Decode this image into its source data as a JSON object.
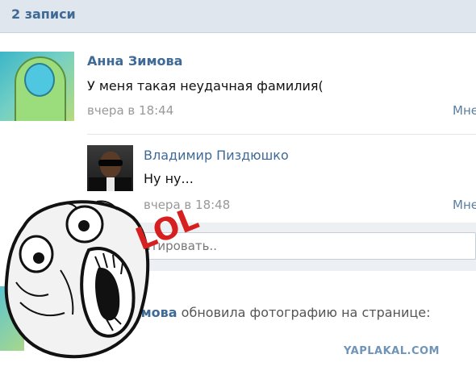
{
  "header": {
    "title": "2 записи"
  },
  "post1": {
    "author": "Анна Зимова",
    "text": "У меня такая неудачная фамилия(",
    "date": "вчера в 18:44",
    "more": "Мне"
  },
  "reply": {
    "author": "Владимир Пиздюшко",
    "text": "Ну ну...",
    "date": "вчера в 18:48",
    "more": "Мне"
  },
  "comment": {
    "placeholder": "мментировать.."
  },
  "post2": {
    "author_part": "Зимова",
    "text": " обновила фотографию на странице:"
  },
  "overlay": {
    "lol_text": "LOL"
  },
  "watermark": "YAPLAKAL.COM"
}
